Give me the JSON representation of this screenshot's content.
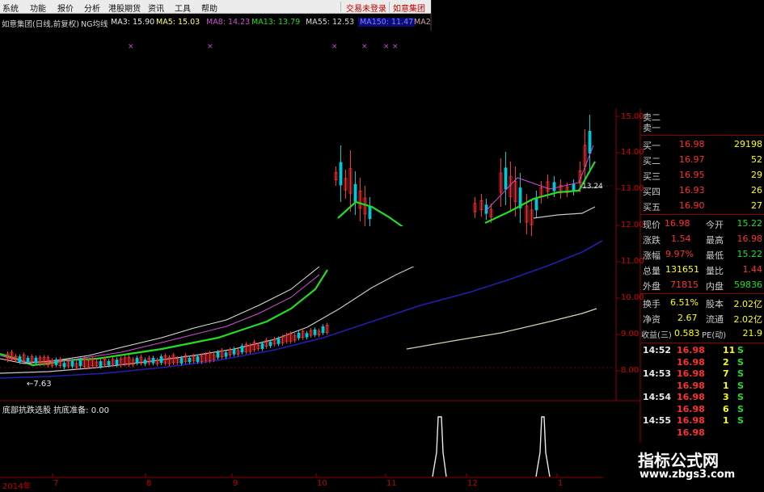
{
  "menu": {
    "items": [
      "系统",
      "功能",
      "报价",
      "分析",
      "港股期货",
      "资讯",
      "工具",
      "帮助"
    ],
    "trade_login": "交易未登录",
    "stock_name_link": "如意集团"
  },
  "infobar": {
    "title": "如意集团(日线,前复权)",
    "indicator": "NG均线",
    "ma3": "MA3: 15.90",
    "ma5": "MA5: 15.03",
    "ma8": "MA8: 14.23",
    "ma13": "MA13: 13.79",
    "ma55": "MA55: 12.53",
    "ma150": "MA150: 11.47",
    "ma2": "MA2"
  },
  "price_axis": [
    "15.00",
    "14.00",
    "13.00",
    "12.00",
    "11.00",
    "10.00",
    "9.00",
    "8.00"
  ],
  "annotations": {
    "low": "←7.63",
    "current": "13.24"
  },
  "sub_panel": {
    "title": "底部抗跌选股 抗底准备: 0.00"
  },
  "x_axis": [
    "2014年",
    "7",
    "8",
    "9",
    "10",
    "11",
    "12",
    "1"
  ],
  "order_book": {
    "sell": [
      {
        "label": "卖二"
      },
      {
        "label": "卖一"
      }
    ],
    "buy": [
      {
        "label": "买一",
        "price": "16.98",
        "volume": "29198"
      },
      {
        "label": "买二",
        "price": "16.97",
        "volume": "52"
      },
      {
        "label": "买三",
        "price": "16.95",
        "volume": "29"
      },
      {
        "label": "买四",
        "price": "16.93",
        "volume": "26"
      },
      {
        "label": "买五",
        "price": "16.90",
        "volume": "27"
      }
    ]
  },
  "quote": [
    {
      "label": "现价",
      "value": "16.98",
      "label2": "今开",
      "value2": "15.22"
    },
    {
      "label": "涨跌",
      "value": "1.54",
      "label2": "最高",
      "value2": "16.98"
    },
    {
      "label": "涨幅",
      "value": "9.97%",
      "label2": "最低",
      "value2": "15.22"
    },
    {
      "label": "总量",
      "value": "131651",
      "label2": "量比",
      "value2": "1.44"
    },
    {
      "label": "外盘",
      "value": "71815",
      "label2": "内盘",
      "value2": "59836"
    },
    {
      "label": "换手",
      "value": "6.51%",
      "label2": "股本",
      "value2": "2.02亿"
    },
    {
      "label": "净资",
      "value": "2.67",
      "label2": "流通",
      "value2": "2.02亿"
    },
    {
      "label": "收益(三)",
      "value": "0.583",
      "label2": "PE(动)",
      "value2": "21.9"
    }
  ],
  "ticks": [
    {
      "time": "14:52",
      "price": "16.98",
      "vol": "11",
      "side": "S"
    },
    {
      "time": "",
      "price": "16.98",
      "vol": "2",
      "side": "S"
    },
    {
      "time": "14:53",
      "price": "16.98",
      "vol": "7",
      "side": "S"
    },
    {
      "time": "",
      "price": "16.98",
      "vol": "1",
      "side": "S"
    },
    {
      "time": "14:54",
      "price": "16.98",
      "vol": "3",
      "side": "S"
    },
    {
      "time": "",
      "price": "16.98",
      "vol": "6",
      "side": "S"
    },
    {
      "time": "14:55",
      "price": "16.98",
      "vol": "1",
      "side": "S"
    },
    {
      "time": "",
      "price": "16.98",
      "vol": "",
      "side": ""
    }
  ],
  "watermark": {
    "title": "指标公式网",
    "url": "www.zbgs3.com"
  },
  "colors": {
    "up": "#e00000",
    "down": "#00c8d8",
    "ma_green": "#22dd22",
    "ma_blue": "#2020b0",
    "ma_white": "#c8c8c8",
    "accent_yellow": "#ffff00"
  }
}
